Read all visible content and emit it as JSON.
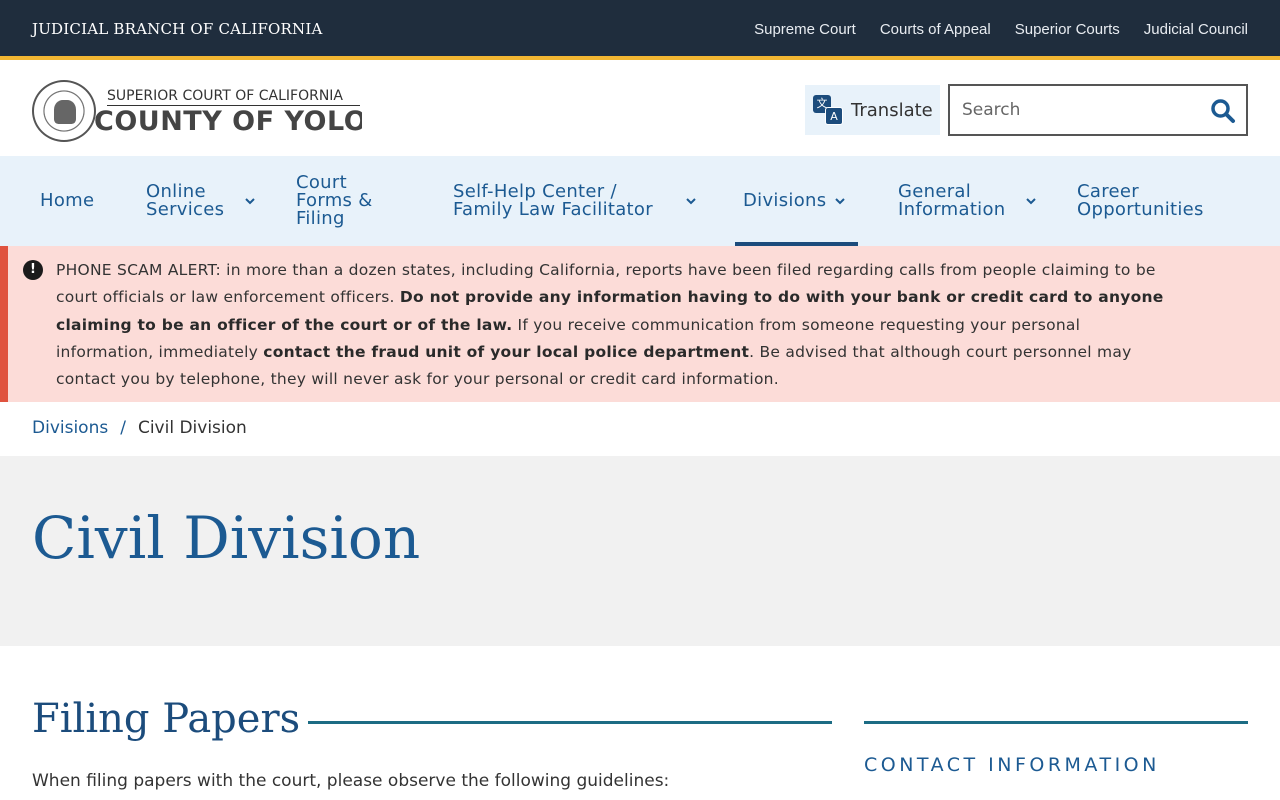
{
  "topbar": {
    "brand": "JUDICIAL BRANCH OF CALIFORNIA",
    "links": [
      "Supreme Court",
      "Courts of Appeal",
      "Superior Courts",
      "Judicial Council"
    ]
  },
  "header": {
    "logo_line1": "SUPERIOR COURT OF CALIFORNIA",
    "logo_line2": "COUNTY OF YOLO",
    "translate_label": "Translate",
    "search_placeholder": "Search"
  },
  "nav": {
    "items": [
      {
        "label": "Home"
      },
      {
        "label": "Online Services"
      },
      {
        "label": "Court Forms & Filing"
      },
      {
        "label": "Self-Help Center / Family Law Facilitator"
      },
      {
        "label": "Divisions"
      },
      {
        "label": "General Information"
      },
      {
        "label": "Career Opportunities"
      }
    ]
  },
  "alert": {
    "title": "PHONE SCAM ALERT",
    "text1": ": in more than a dozen states, including California, reports have been filed regarding calls from people claiming to be court officials or law enforcement officers. ",
    "bold1": "Do not provide any information having to do with your bank or credit card to anyone claiming to be an officer of the court or of the law.",
    "text2": " If you receive communication from someone requesting your personal information, immediately ",
    "bold2": "contact the fraud unit of your local police department",
    "text3": ". Be advised that although court personnel may contact you by telephone, they will never ask for your personal or credit card information."
  },
  "breadcrumb": {
    "parent": "Divisions",
    "separator": "/",
    "current": "Civil Division"
  },
  "page": {
    "title": "Civil Division",
    "section_title": "Filing Papers",
    "intro": "When filing papers with the court, please observe the following guidelines:",
    "sidebar_title": "CONTACT INFORMATION"
  },
  "colors": {
    "topbar_bg": "#1f2d3d",
    "accent_gold": "#f2b632",
    "nav_bg": "#e8f2fa",
    "link_blue": "#1c5a92",
    "alert_bg": "#fcdcd8",
    "alert_border": "#e0533f"
  }
}
